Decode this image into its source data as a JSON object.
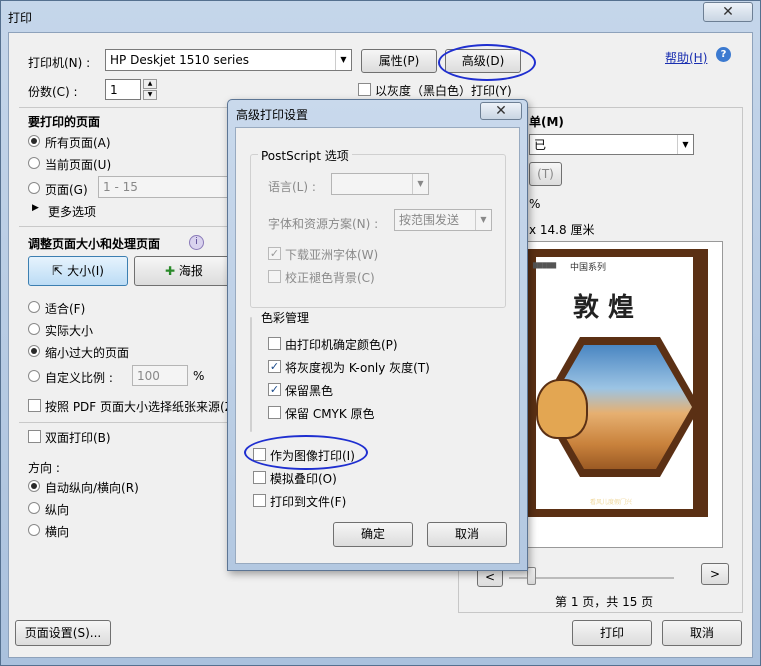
{
  "window": {
    "title": "打印",
    "close": "✕"
  },
  "printer": {
    "label": "打印机(N) :",
    "value": "HP Deskjet 1510 series",
    "properties": "属性(P)",
    "advanced": "高级(D)"
  },
  "help": {
    "label": "帮助(H)",
    "icon": "?"
  },
  "copies": {
    "label": "份数(C) :",
    "value": "1"
  },
  "grayscale": {
    "label": "以灰度（黑白色）打印(Y)"
  },
  "pages": {
    "heading": "要打印的页面",
    "all": "所有页面(A)",
    "current": "当前页面(U)",
    "range_label": "页面(G)",
    "range_value": "1 - 15",
    "more": "更多选项"
  },
  "sizing": {
    "heading": "调整页面大小和处理页面",
    "size_btn": "大小(I)",
    "poster_btn": "海报",
    "fit": "适合(F)",
    "actual": "实际大小",
    "shrink": "缩小过大的页面",
    "custom": "自定义比例 :",
    "custom_value": "100",
    "percent": "%",
    "pdf_source": "按照 PDF 页面大小选择纸张来源(Z)"
  },
  "duplex": {
    "label": "双面打印(B)"
  },
  "orientation": {
    "heading": "方向 :",
    "auto": "自动纵向/横向(R)",
    "portrait": "纵向",
    "landscape": "横向"
  },
  "right_panel": {
    "comments_heading": "单(M)",
    "comments_value": "已",
    "summary_btn": "(T)",
    "scale_label": "%",
    "paper_size": "x 14.8 厘米",
    "page_info": "第 1 页，共 15 页",
    "prev": "<",
    "next": ">"
  },
  "preview": {
    "series": "中国系列",
    "title": "敦 煌",
    "footer": "看风儿度假门兴"
  },
  "bottom": {
    "page_setup": "页面设置(S)...",
    "print": "打印",
    "cancel": "取消"
  },
  "advanced_dialog": {
    "title": "高级打印设置",
    "close": "✕",
    "postscript": {
      "heading": "PostScript 选项",
      "language_label": "语言(L) :",
      "language_value": "",
      "font_label": "字体和资源方案(N) :",
      "font_value": "按范围发送",
      "download_asian": "下载亚洲字体(W)",
      "correct_bg": "校正褪色背景(C)"
    },
    "color": {
      "heading": "色彩管理",
      "printer_color": "由打印机确定颜色(P)",
      "gray_konly": "将灰度视为 K-only 灰度(T)",
      "keep_black": "保留黑色",
      "keep_cmyk": "保留 CMYK 原色"
    },
    "print_as_image": "作为图像打印(I)",
    "simulate_overprint": "模拟叠印(O)",
    "print_to_file": "打印到文件(F)",
    "ok": "确定",
    "cancel": "取消"
  }
}
